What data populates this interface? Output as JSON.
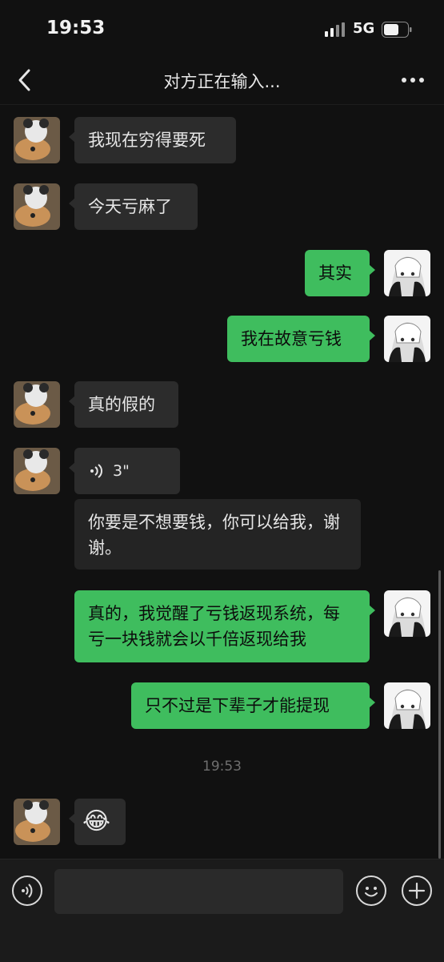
{
  "status_bar": {
    "time": "19:53",
    "network": "5G"
  },
  "nav": {
    "title": "对方正在输入..."
  },
  "messages": [
    {
      "text": "我现在穷得要死"
    },
    {
      "text": "今天亏麻了"
    },
    {
      "text": "其实"
    },
    {
      "text": "我在故意亏钱"
    },
    {
      "text": "真的假的"
    },
    {
      "voice_length": "3\""
    },
    {
      "text": "你要是不想要钱，你可以给我，谢谢。"
    },
    {
      "text": "真的，我觉醒了亏钱返现系统，每亏一块钱就会以千倍返现给我"
    },
    {
      "text": "只不过是下辈子才能提现"
    },
    {
      "emoji": "😂"
    }
  ],
  "timestamp": "19:53",
  "input": {
    "value": ""
  },
  "colors": {
    "incoming_bubble": "#2c2c2c",
    "outgoing_bubble": "#3fbd5e",
    "background": "#111111"
  },
  "icons": [
    "back-icon",
    "more-icon",
    "voice-icon",
    "emoji-icon",
    "plus-icon"
  ]
}
